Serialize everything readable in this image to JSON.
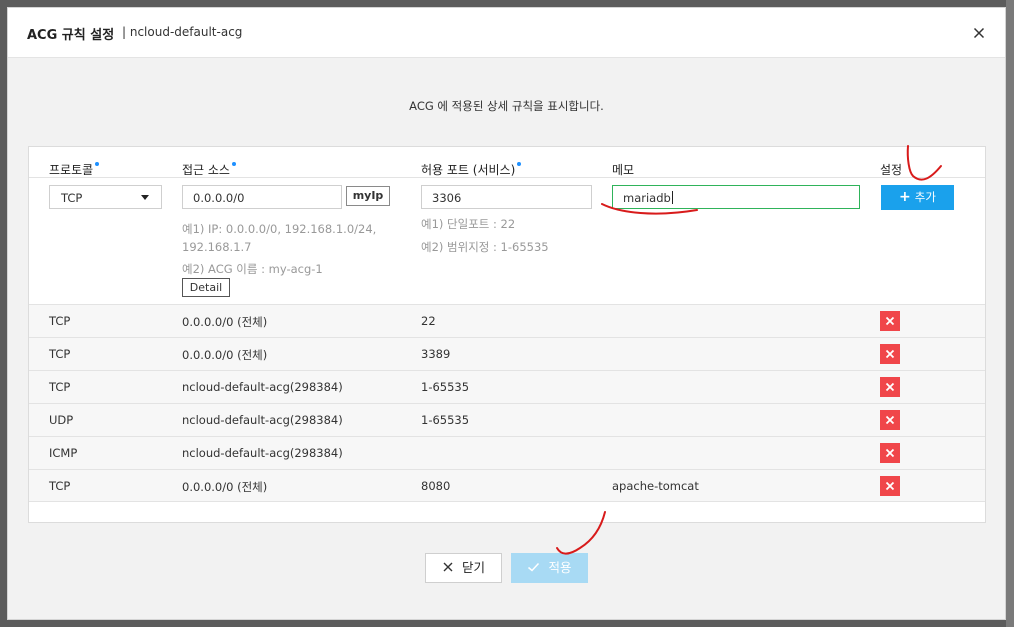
{
  "modal": {
    "title": "ACG 규칙 설정",
    "subtitle": "| ncloud-default-acg",
    "close_icon": "close-icon",
    "description": "ACG 에 적용된 상세 규칙을 표시합니다."
  },
  "table": {
    "headers": {
      "protocol": "프로토콜",
      "source": "접근 소스",
      "port": "허용 포트 (서비스)",
      "memo": "메모",
      "setting": "설정"
    },
    "required_dot_color": "#1e90ff",
    "new_rule": {
      "protocol": "TCP",
      "source_value": "0.0.0.0/0",
      "myip_label": "myIp",
      "source_hint_1": "예1) IP: 0.0.0.0/0, 192.168.1.0/24,",
      "source_hint_2": "192.168.1.7",
      "source_hint_3": "예2) ACG 이름 : my-acg-1",
      "detail_label": "Detail",
      "port_value": "3306",
      "port_hint_1": "예1) 단일포트 : 22",
      "port_hint_2": "예2) 범위지정 : 1-65535",
      "memo_value": "mariadb",
      "add_label": "추가",
      "add_color": "#1aa1ec"
    },
    "rules": [
      {
        "protocol": "TCP",
        "source": "0.0.0.0/0 (전체)",
        "port": "22",
        "memo": ""
      },
      {
        "protocol": "TCP",
        "source": "0.0.0.0/0 (전체)",
        "port": "3389",
        "memo": ""
      },
      {
        "protocol": "TCP",
        "source": "ncloud-default-acg(298384)",
        "port": "1-65535",
        "memo": ""
      },
      {
        "protocol": "UDP",
        "source": "ncloud-default-acg(298384)",
        "port": "1-65535",
        "memo": ""
      },
      {
        "protocol": "ICMP",
        "source": "ncloud-default-acg(298384)",
        "port": "",
        "memo": ""
      },
      {
        "protocol": "TCP",
        "source": "0.0.0.0/0 (전체)",
        "port": "8080",
        "memo": "apache-tomcat"
      }
    ],
    "delete_color": "#f0464a"
  },
  "footer": {
    "close_label": "닫기",
    "apply_label": "적용",
    "apply_color": "#a8daf4"
  },
  "annotation_color": "#d81b1b"
}
